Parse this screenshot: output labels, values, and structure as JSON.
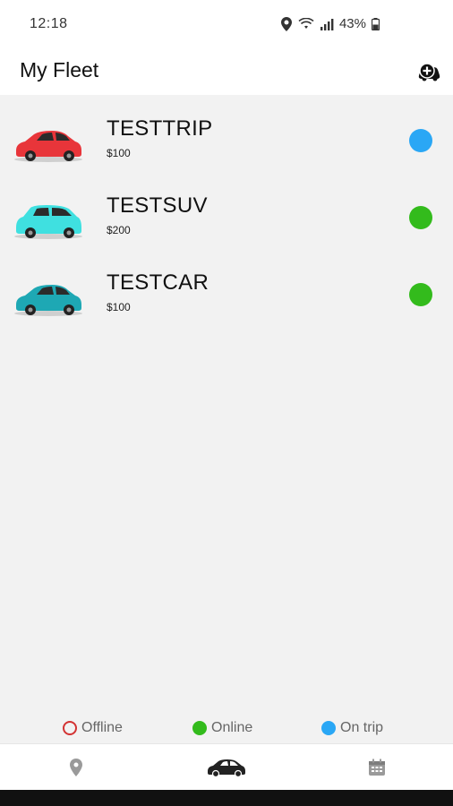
{
  "status_bar": {
    "time": "12:18",
    "battery": "43%"
  },
  "header": {
    "title": "My Fleet",
    "add_icon": "add-car-icon"
  },
  "vehicles": [
    {
      "name": "TESTTRIP",
      "price": "$100",
      "car_color": "#e8353a",
      "status": "on_trip",
      "status_color": "#2aa7f5"
    },
    {
      "name": "TESTSUV",
      "price": "$200",
      "car_color": "#3fe0e0",
      "status": "online",
      "status_color": "#33bb1c"
    },
    {
      "name": "TESTCAR",
      "price": "$100",
      "car_color": "#1ea8b4",
      "status": "online",
      "status_color": "#33bb1c"
    }
  ],
  "legend": {
    "offline": "Offline",
    "online": "Online",
    "on_trip": "On trip",
    "colors": {
      "offline": "#d33333",
      "online": "#33bb1c",
      "on_trip": "#2aa7f5"
    }
  },
  "bottom_nav": [
    {
      "icon": "location-pin-icon",
      "active": false
    },
    {
      "icon": "car-icon",
      "active": true
    },
    {
      "icon": "calendar-icon",
      "active": false
    }
  ]
}
